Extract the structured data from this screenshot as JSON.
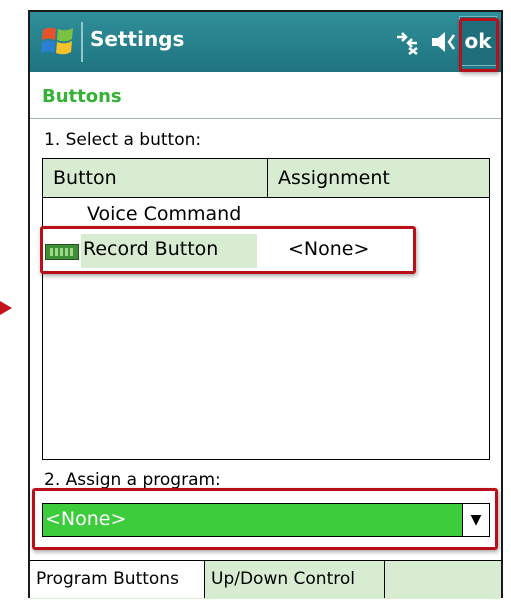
{
  "window": {
    "title": "Settings",
    "ok_label": "ok",
    "connectivity_icon": "connectivity-icon",
    "volume_icon": "speaker-icon",
    "start_icon": "windows-flag-icon"
  },
  "section": {
    "title": "Buttons"
  },
  "step1": {
    "label": "1. Select a button:"
  },
  "list": {
    "columns": [
      "Button",
      "Assignment"
    ],
    "rows": [
      {
        "name": "Voice Command",
        "assignment": ""
      },
      {
        "name": "Record Button",
        "assignment": "<None>"
      }
    ]
  },
  "step2": {
    "label": "2. Assign a program:"
  },
  "program_select": {
    "value": "<None>"
  },
  "tabs": [
    "Program Buttons",
    "Up/Down Control"
  ],
  "colors": {
    "titlebar": "#1f7480",
    "accent_green": "#34b234",
    "selection_green": "#3ccc3c",
    "annotation_red": "#b80f1b"
  }
}
